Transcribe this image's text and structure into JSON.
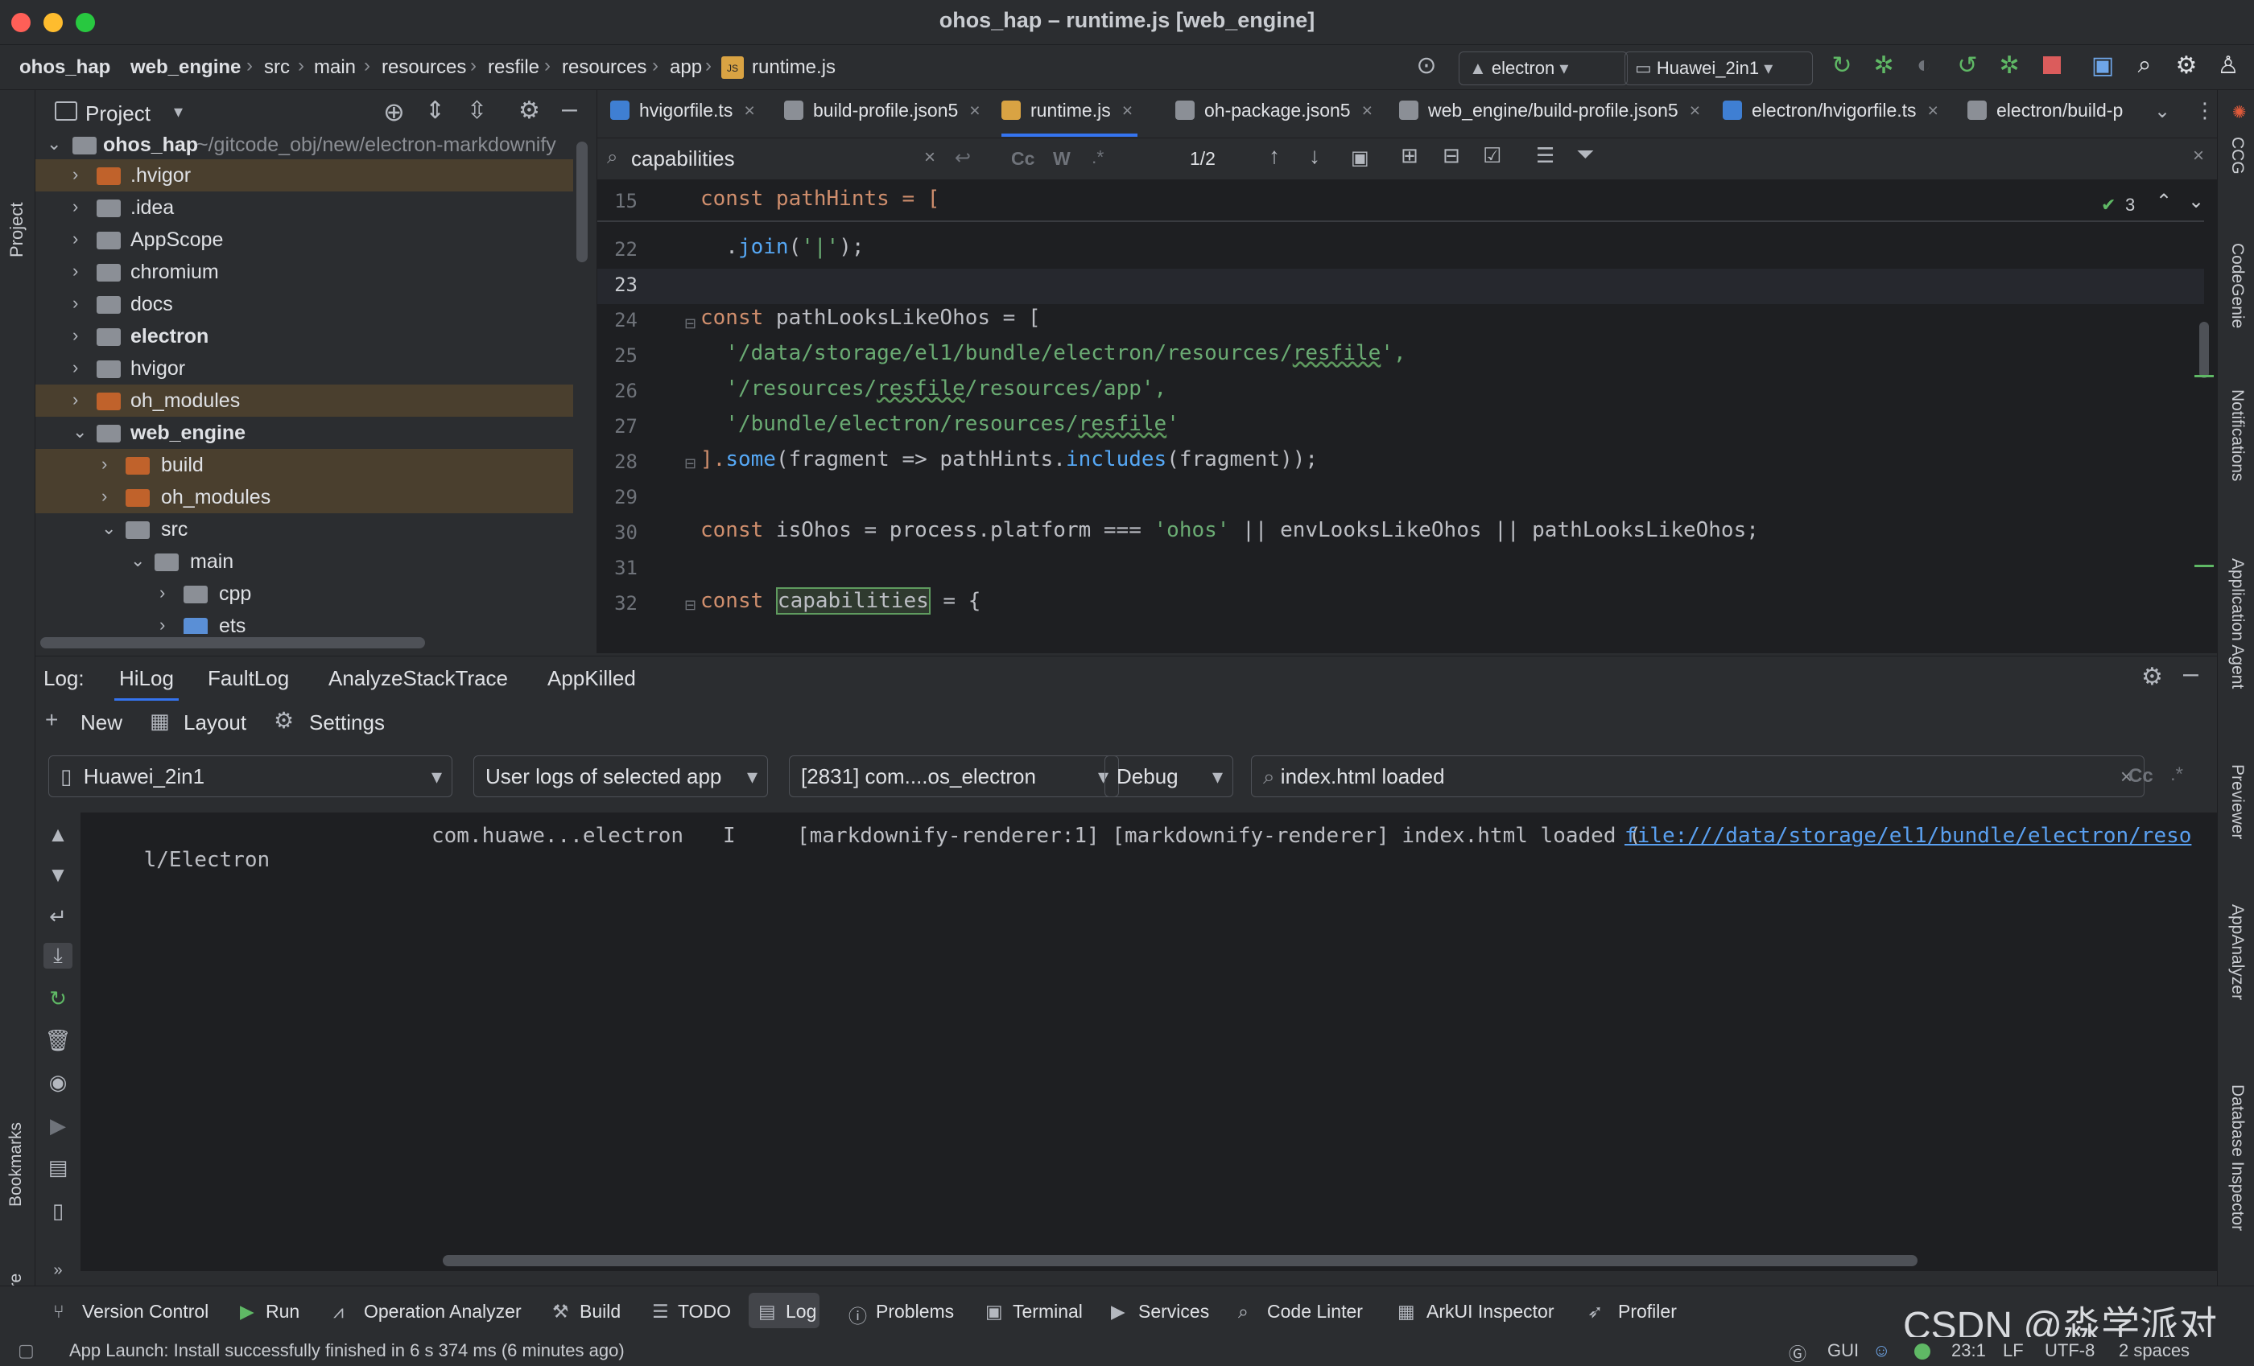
{
  "window": {
    "title": "ohos_hap – runtime.js [web_engine]"
  },
  "breadcrumb": [
    "ohos_hap",
    "web_engine",
    "src",
    "main",
    "resources",
    "resfile",
    "resources",
    "app",
    "runtime.js"
  ],
  "toolbar": {
    "run_config": "electron",
    "device": "Huawei_2in1"
  },
  "project_panel": {
    "title": "Project",
    "tree": [
      {
        "label": "ohos_hap",
        "suffix": " ~/gitcode_obj/new/electron-markdownify",
        "bold": true
      },
      {
        "label": ".hvigor"
      },
      {
        "label": ".idea"
      },
      {
        "label": "AppScope"
      },
      {
        "label": "chromium"
      },
      {
        "label": "docs"
      },
      {
        "label": "electron",
        "bold": true
      },
      {
        "label": "hvigor"
      },
      {
        "label": "oh_modules"
      },
      {
        "label": "web_engine",
        "bold": true
      },
      {
        "label": "build"
      },
      {
        "label": "oh_modules"
      },
      {
        "label": "src"
      },
      {
        "label": "main"
      },
      {
        "label": "cpp"
      },
      {
        "label": "ets"
      }
    ]
  },
  "editor_tabs": [
    "hvigorfile.ts",
    "build-profile.json5",
    "runtime.js",
    "oh-package.json5",
    "web_engine/build-profile.json5",
    "electron/hvigorfile.ts",
    "electron/build-p"
  ],
  "find": {
    "query": "capabilities",
    "match_count": "1/2",
    "opts": [
      "Cc",
      "W",
      ".*"
    ]
  },
  "inspections": {
    "count": "3"
  },
  "code": {
    "line_numbers": [
      "15",
      "22",
      "23",
      "24",
      "25",
      "26",
      "27",
      "28",
      "29",
      "30",
      "31",
      "32"
    ],
    "sticky": "const pathHints = [",
    "l22": "  .join('|');",
    "l24a": "const ",
    "l24b": "pathLooksLikeOhos",
    "l24c": " = [",
    "l25a": "  '/data/storage/el1/bundle/electron/resources/",
    "l25b": "resfile",
    "l25c": "',",
    "l26a": "  '/resources/",
    "l26b": "resfile",
    "l26c": "/resources/app',",
    "l27a": "  '/bundle/electron/resources/",
    "l27b": "resfile",
    "l27c": "'",
    "l28a": "].",
    "l28b": "some",
    "l28c": "(fragment => pathHints.",
    "l28d": "includes",
    "l28e": "(fragment));",
    "l30a": "const ",
    "l30b": "isOhos = process.platform === ",
    "l30c": "'ohos'",
    "l30d": " || envLooksLikeOhos || pathLooksLikeOhos;",
    "l32a": "const ",
    "l32b": "capabilities",
    "l32c": " = {"
  },
  "log_panel": {
    "label": "Log:",
    "tabs": [
      "HiLog",
      "FaultLog",
      "AnalyzeStackTrace",
      "AppKilled"
    ],
    "actions": [
      "New",
      "Layout",
      "Settings"
    ],
    "filters": {
      "device": "Huawei_2in1",
      "scope": "User logs of selected app",
      "process": "[2831] com....os_electron",
      "level": "Debug",
      "search": "index.html loaded",
      "opts": [
        "Cc",
        ".*"
      ]
    },
    "entry": {
      "tag": "l/Electron",
      "package": "com.huawe...electron",
      "level": "I",
      "message": "[markdownify-renderer:1] [markdownify-renderer] index.html loaded (",
      "link": "file:///data/storage/el1/bundle/electron/reso"
    }
  },
  "left_strip": [
    "Project",
    "Bookmarks",
    "Structure"
  ],
  "right_strip": [
    "CCG",
    "CodeGenie",
    "Notifications",
    "Application Agent",
    "Previewer",
    "AppAnalyzer",
    "Database Inspector"
  ],
  "bottom_tools": [
    "Version Control",
    "Run",
    "Operation Analyzer",
    "Build",
    "TODO",
    "Log",
    "Problems",
    "Terminal",
    "Services",
    "Code Linter",
    "ArkUI Inspector",
    "Profiler"
  ],
  "status": {
    "message": "App Launch: Install successfully finished in 6 s 374 ms (6 minutes ago)",
    "gui": "GUI",
    "position": "23:1",
    "line_sep": "LF",
    "encoding": "UTF-8",
    "indent": "2 spaces"
  },
  "watermark": "CSDN @淼学派对",
  "colors": {
    "accent": "#3574f0",
    "folder_orange": "#c0622b",
    "highlight": "#4a3f2e",
    "editor_bg": "#1e1f22",
    "panel_bg": "#2b2d30"
  }
}
